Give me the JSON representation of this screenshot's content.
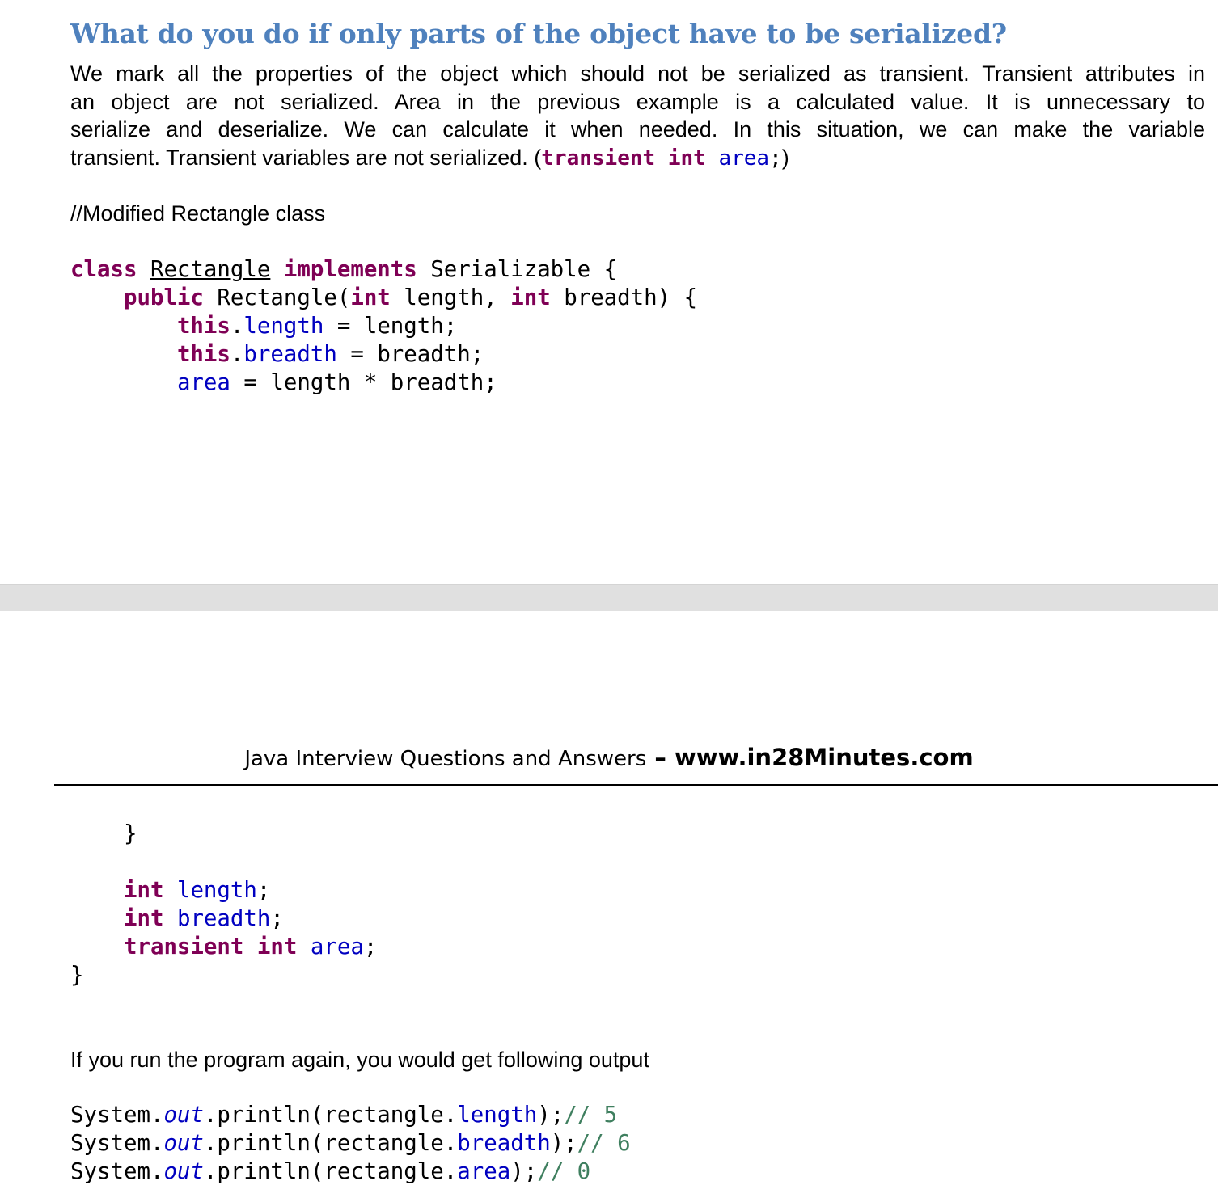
{
  "heading": "What do you do if only parts of the object have to be serialized?",
  "paragraph": {
    "lines": [
      "We mark all the properties of the object which should not be serialized as transient. Transient attributes in",
      "an object are not serialized. Area in the previous example is a calculated value. It is unnecessary to",
      "serialize and deserialize. We can calculate it when needed. In this situation, we can make the variable"
    ],
    "last_line_prefix": "transient. Transient variables are not serialized. (",
    "inline_code": {
      "kw1": "transient",
      "kw2": "int",
      "field": "area",
      "suffix": ";"
    },
    "last_line_suffix": ")"
  },
  "code_comment": "//Modified Rectangle class",
  "code_top": {
    "l1_kw_class": "class",
    "l1_name": "Rectangle",
    "l1_kw_implements": "implements",
    "l1_rest": " Serializable {",
    "l2_kw_public": "public",
    "l2_a": " Rectangle(",
    "l2_kw_int1": "int",
    "l2_b": " length, ",
    "l2_kw_int2": "int",
    "l2_c": " breadth) {",
    "l3_kw_this": "this",
    "l3_dot": ".",
    "l3_field": "length",
    "l3_rest": " = length;",
    "l4_kw_this": "this",
    "l4_dot": ".",
    "l4_field": "breadth",
    "l4_rest": " = breadth;",
    "l5_field": "area",
    "l5_rest": " = length * breadth;"
  },
  "footer": {
    "text": "Java Interview Questions and Answers",
    "dash": " – ",
    "site": "www.in28Minutes.com"
  },
  "code_bottom": {
    "close_ctor": "}",
    "f1_kw": "int",
    "f1_name": "length",
    "f1_semi": ";",
    "f2_kw": "int",
    "f2_name": "breadth",
    "f2_semi": ";",
    "f3_kw1": "transient",
    "f3_kw2": "int",
    "f3_name": "area",
    "f3_semi": ";",
    "close_class": "}"
  },
  "output_label": "If you run the program again, you would get following output",
  "output_code": [
    {
      "a": "System.",
      "static": "out",
      "b": ".println(rectangle.",
      "field": "length",
      "c": ");",
      "comment": "// 5"
    },
    {
      "a": "System.",
      "static": "out",
      "b": ".println(rectangle.",
      "field": "breadth",
      "c": ");",
      "comment": "// 6"
    },
    {
      "a": "System.",
      "static": "out",
      "b": ".println(rectangle.",
      "field": "area",
      "c": ");",
      "comment": "// 0"
    }
  ]
}
